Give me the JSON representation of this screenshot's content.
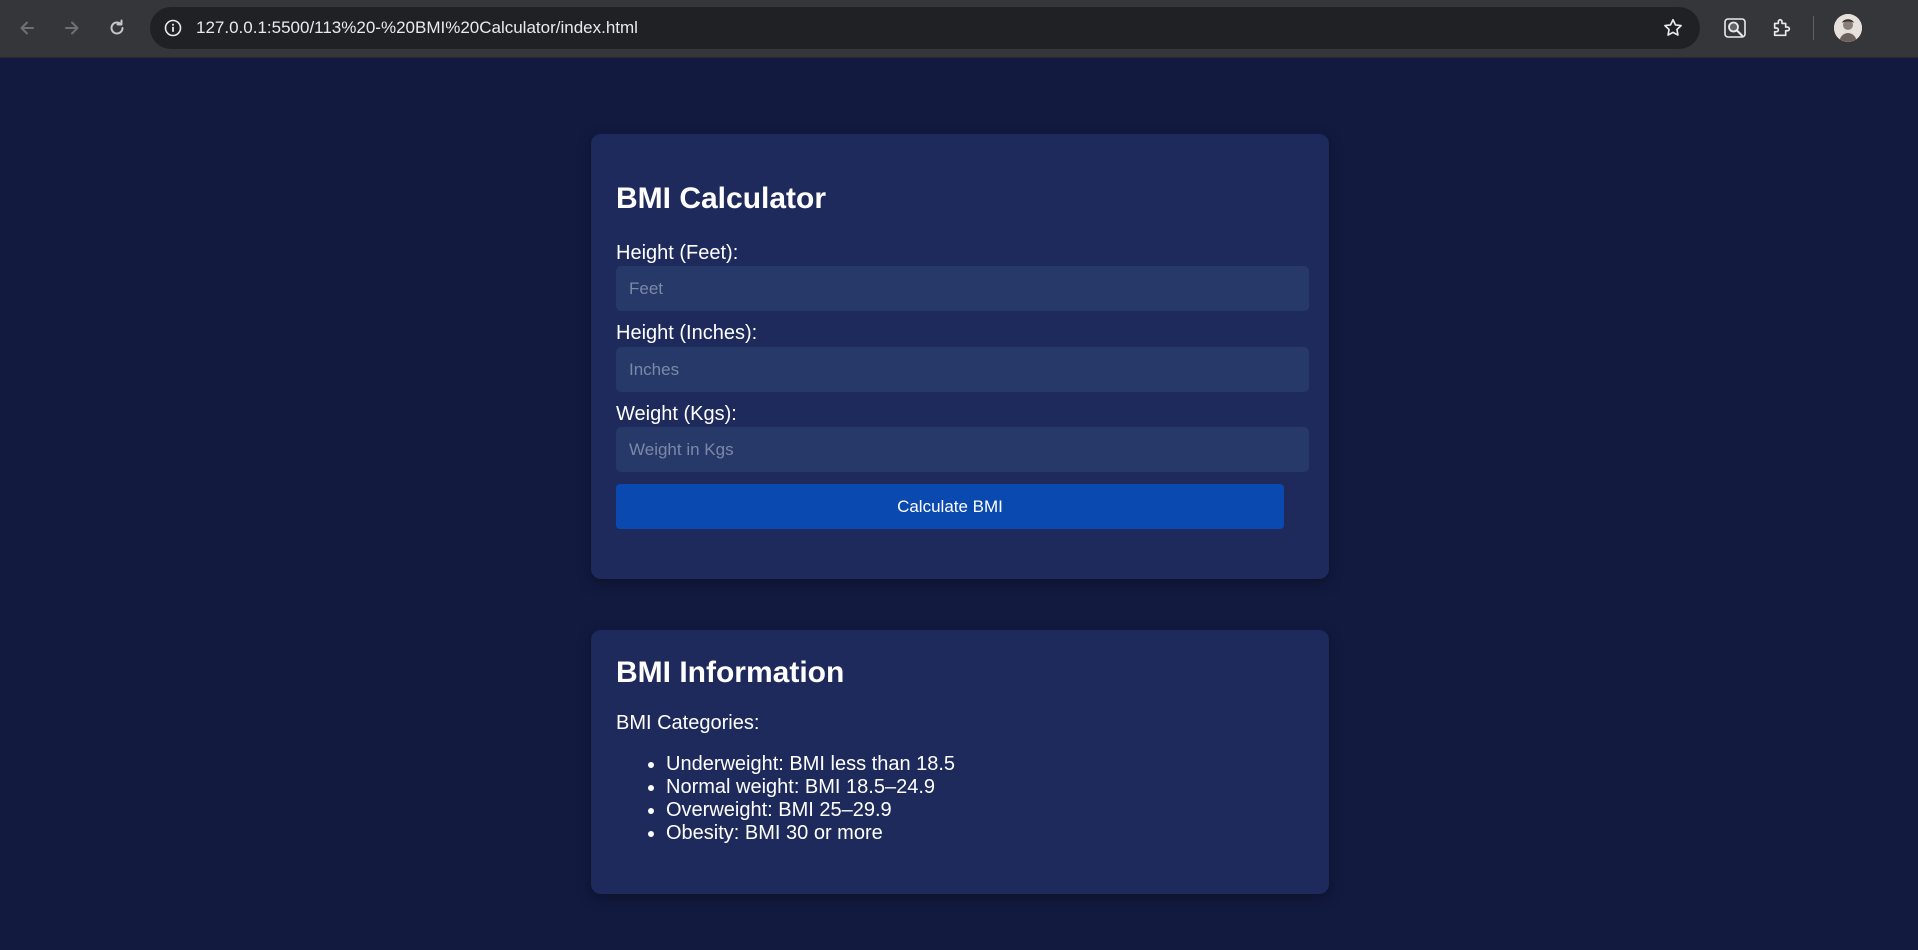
{
  "browser": {
    "url": "127.0.0.1:5500/113%20-%20BMI%20Calculator/index.html"
  },
  "calculator": {
    "title": "BMI Calculator",
    "fields": [
      {
        "label": "Height (Feet):",
        "placeholder": "Feet",
        "value": ""
      },
      {
        "label": "Height (Inches):",
        "placeholder": "Inches",
        "value": ""
      },
      {
        "label": "Weight (Kgs):",
        "placeholder": "Weight in Kgs",
        "value": ""
      }
    ],
    "button_label": "Calculate BMI"
  },
  "info": {
    "title": "BMI Information",
    "subtitle": "BMI Categories:",
    "categories": [
      "Underweight: BMI less than 18.5",
      "Normal weight: BMI 18.5–24.9",
      "Overweight: BMI 25–29.9",
      "Obesity: BMI 30 or more"
    ]
  },
  "colors": {
    "page_background": "#121a40",
    "card_background": "#1f2a5c",
    "input_background": "#263968",
    "button_background": "#0a4ab0"
  }
}
